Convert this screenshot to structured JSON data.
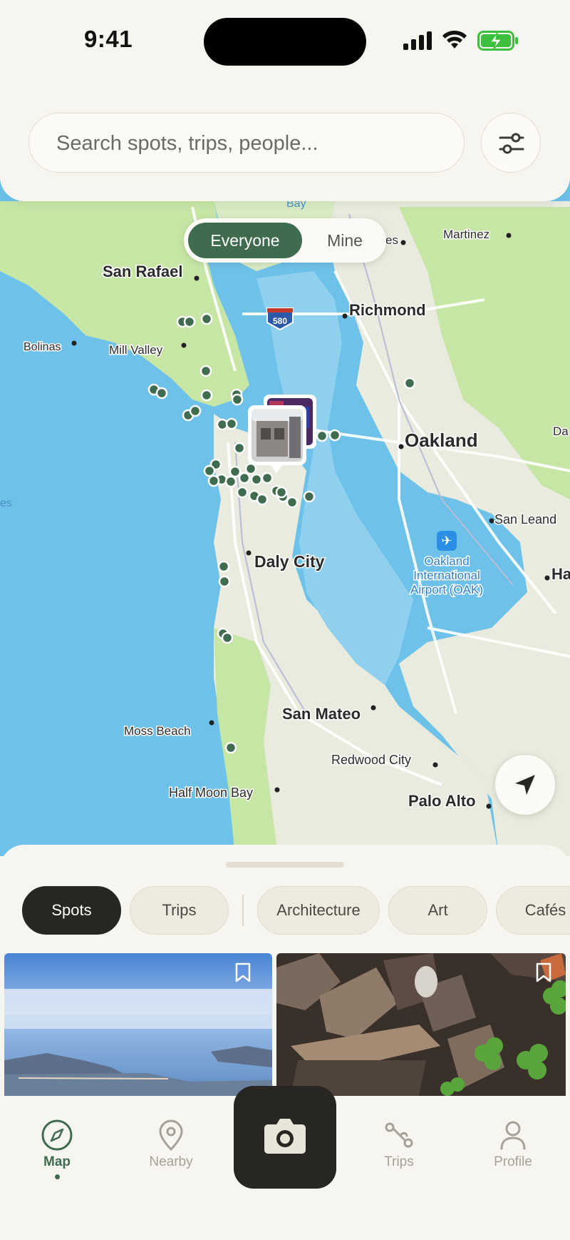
{
  "status": {
    "time": "9:41"
  },
  "search": {
    "placeholder": "Search spots, trips, people..."
  },
  "map": {
    "segment": {
      "everyone": "Everyone",
      "mine": "Mine",
      "selected": "Everyone"
    },
    "labels": {
      "san_rafael": "San Rafael",
      "richmond": "Richmond",
      "martinez": "Martinez",
      "bolinas": "Bolinas",
      "mill_valley": "Mill Valley",
      "oakland": "Oakland",
      "san_leandro": "San Leand",
      "daly_city": "Daly City",
      "airport": "Oakland International Airport (OAK)",
      "airport_l1": "Oakland",
      "airport_l2": "International",
      "airport_l3": "Airport (OAK)",
      "san_mateo": "San Mateo",
      "moss_beach": "Moss Beach",
      "redwood_city": "Redwood City",
      "half_moon_bay": "Half Moon Bay",
      "palo_alto": "Palo Alto",
      "bay": "Bay",
      "es": "es",
      "ha": "Ha",
      "da": "Da",
      "hwy": "580"
    }
  },
  "sheet": {
    "chips": [
      "Spots",
      "Trips",
      "Architecture",
      "Art",
      "Cafés"
    ],
    "active_chip": "Spots"
  },
  "tabbar": {
    "map": "Map",
    "nearby": "Nearby",
    "trips": "Trips",
    "profile": "Profile",
    "active": "Map"
  },
  "colors": {
    "accent": "#3f6b4e",
    "dark": "#272623",
    "bg": "#f7f5f0"
  }
}
